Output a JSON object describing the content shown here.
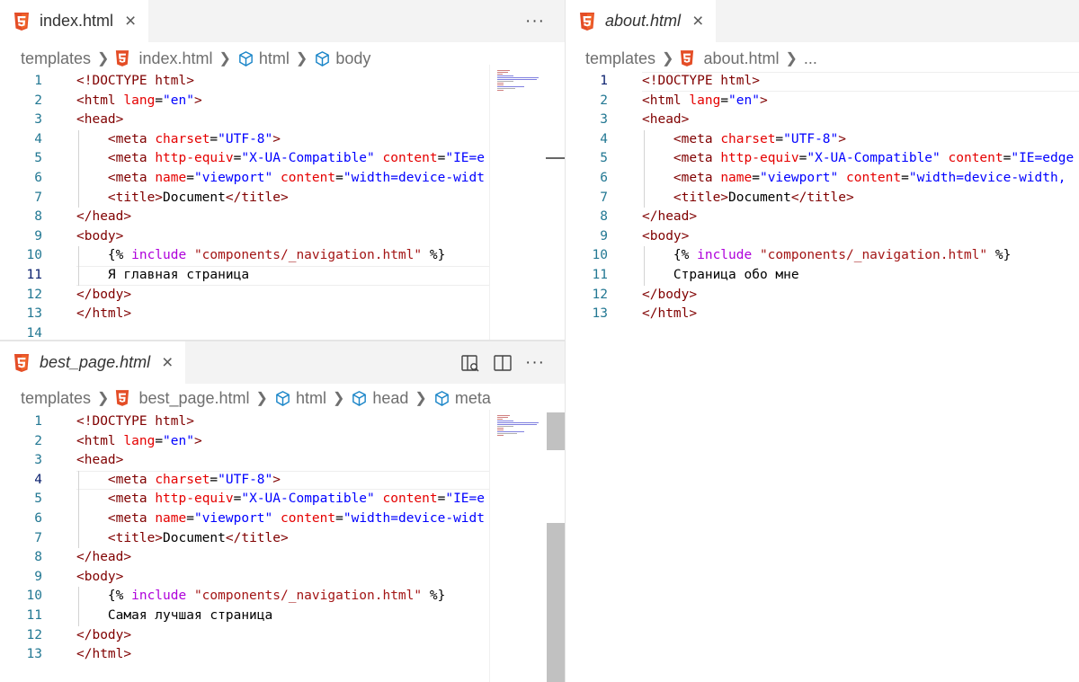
{
  "breadcrumb_root": "templates",
  "editors": {
    "index": {
      "tab": {
        "label": "index.html",
        "close": "×",
        "more": "···"
      },
      "breadcrumb": [
        "index.html",
        "html",
        "body"
      ],
      "lines": [
        {
          "n": "1",
          "parts": [
            [
              "t-tag",
              "<!DOCTYPE html>"
            ]
          ]
        },
        {
          "n": "2",
          "parts": [
            [
              "t-tag",
              "<html "
            ],
            [
              "t-attr",
              "lang"
            ],
            [
              "t-txt",
              "="
            ],
            [
              "t-str",
              "\"en\""
            ],
            [
              "t-tag",
              ">"
            ]
          ]
        },
        {
          "n": "3",
          "parts": [
            [
              "t-tag",
              "<head>"
            ]
          ]
        },
        {
          "n": "4",
          "parts": [
            [
              "t-txt",
              "    "
            ],
            [
              "t-tag",
              "<meta "
            ],
            [
              "t-attr",
              "charset"
            ],
            [
              "t-txt",
              "="
            ],
            [
              "t-str",
              "\"UTF-8\""
            ],
            [
              "t-tag",
              ">"
            ]
          ]
        },
        {
          "n": "5",
          "parts": [
            [
              "t-txt",
              "    "
            ],
            [
              "t-tag",
              "<meta "
            ],
            [
              "t-attr",
              "http-equiv"
            ],
            [
              "t-txt",
              "="
            ],
            [
              "t-str",
              "\"X-UA-Compatible\""
            ],
            [
              "t-txt",
              " "
            ],
            [
              "t-attr",
              "content"
            ],
            [
              "t-txt",
              "="
            ],
            [
              "t-str",
              "\"IE=e"
            ]
          ]
        },
        {
          "n": "6",
          "parts": [
            [
              "t-txt",
              "    "
            ],
            [
              "t-tag",
              "<meta "
            ],
            [
              "t-attr",
              "name"
            ],
            [
              "t-txt",
              "="
            ],
            [
              "t-str",
              "\"viewport\""
            ],
            [
              "t-txt",
              " "
            ],
            [
              "t-attr",
              "content"
            ],
            [
              "t-txt",
              "="
            ],
            [
              "t-str",
              "\"width=device-widt"
            ]
          ]
        },
        {
          "n": "7",
          "parts": [
            [
              "t-txt",
              "    "
            ],
            [
              "t-tag",
              "<title>"
            ],
            [
              "t-txt",
              "Document"
            ],
            [
              "t-tag",
              "</title>"
            ]
          ]
        },
        {
          "n": "8",
          "parts": [
            [
              "t-tag",
              "</head>"
            ]
          ]
        },
        {
          "n": "9",
          "parts": [
            [
              "t-tag",
              "<body>"
            ]
          ]
        },
        {
          "n": "10",
          "parts": [
            [
              "t-txt",
              "    {% "
            ],
            [
              "t-kw",
              "include"
            ],
            [
              "t-txt",
              " "
            ],
            [
              "t-str2",
              "\"components/_navigation.html\""
            ],
            [
              "t-txt",
              " %}"
            ]
          ]
        },
        {
          "n": "11",
          "parts": [
            [
              "t-txt",
              "    Я главная страница"
            ]
          ]
        },
        {
          "n": "12",
          "parts": [
            [
              "t-tag",
              "</body>"
            ]
          ]
        },
        {
          "n": "13",
          "parts": [
            [
              "t-tag",
              "</html>"
            ]
          ]
        },
        {
          "n": "14",
          "parts": []
        }
      ],
      "active_line": "11"
    },
    "about": {
      "tab": {
        "label": "about.html",
        "close": "×"
      },
      "breadcrumb": [
        "about.html",
        "..."
      ],
      "lines": [
        {
          "n": "1",
          "parts": [
            [
              "t-tag",
              "<!DOCTYPE html>"
            ]
          ]
        },
        {
          "n": "2",
          "parts": [
            [
              "t-tag",
              "<html "
            ],
            [
              "t-attr",
              "lang"
            ],
            [
              "t-txt",
              "="
            ],
            [
              "t-str",
              "\"en\""
            ],
            [
              "t-tag",
              ">"
            ]
          ]
        },
        {
          "n": "3",
          "parts": [
            [
              "t-tag",
              "<head>"
            ]
          ]
        },
        {
          "n": "4",
          "parts": [
            [
              "t-txt",
              "    "
            ],
            [
              "t-tag",
              "<meta "
            ],
            [
              "t-attr",
              "charset"
            ],
            [
              "t-txt",
              "="
            ],
            [
              "t-str",
              "\"UTF-8\""
            ],
            [
              "t-tag",
              ">"
            ]
          ]
        },
        {
          "n": "5",
          "parts": [
            [
              "t-txt",
              "    "
            ],
            [
              "t-tag",
              "<meta "
            ],
            [
              "t-attr",
              "http-equiv"
            ],
            [
              "t-txt",
              "="
            ],
            [
              "t-str",
              "\"X-UA-Compatible\""
            ],
            [
              "t-txt",
              " "
            ],
            [
              "t-attr",
              "content"
            ],
            [
              "t-txt",
              "="
            ],
            [
              "t-str",
              "\"IE=edge"
            ]
          ]
        },
        {
          "n": "6",
          "parts": [
            [
              "t-txt",
              "    "
            ],
            [
              "t-tag",
              "<meta "
            ],
            [
              "t-attr",
              "name"
            ],
            [
              "t-txt",
              "="
            ],
            [
              "t-str",
              "\"viewport\""
            ],
            [
              "t-txt",
              " "
            ],
            [
              "t-attr",
              "content"
            ],
            [
              "t-txt",
              "="
            ],
            [
              "t-str",
              "\"width=device-width,"
            ]
          ]
        },
        {
          "n": "7",
          "parts": [
            [
              "t-txt",
              "    "
            ],
            [
              "t-tag",
              "<title>"
            ],
            [
              "t-txt",
              "Document"
            ],
            [
              "t-tag",
              "</title>"
            ]
          ]
        },
        {
          "n": "8",
          "parts": [
            [
              "t-tag",
              "</head>"
            ]
          ]
        },
        {
          "n": "9",
          "parts": [
            [
              "t-tag",
              "<body>"
            ]
          ]
        },
        {
          "n": "10",
          "parts": [
            [
              "t-txt",
              "    {% "
            ],
            [
              "t-kw",
              "include"
            ],
            [
              "t-txt",
              " "
            ],
            [
              "t-str2",
              "\"components/_navigation.html\""
            ],
            [
              "t-txt",
              " %}"
            ]
          ]
        },
        {
          "n": "11",
          "parts": [
            [
              "t-txt",
              "    Страница обо мне"
            ]
          ]
        },
        {
          "n": "12",
          "parts": [
            [
              "t-tag",
              "</body>"
            ]
          ]
        },
        {
          "n": "13",
          "parts": [
            [
              "t-tag",
              "</html>"
            ]
          ]
        }
      ],
      "active_line": "1"
    },
    "best": {
      "tab": {
        "label": "best_page.html",
        "close": "×",
        "more": "···"
      },
      "breadcrumb": [
        "best_page.html",
        "html",
        "head",
        "meta"
      ],
      "lines": [
        {
          "n": "1",
          "parts": [
            [
              "t-tag",
              "<!DOCTYPE html>"
            ]
          ]
        },
        {
          "n": "2",
          "parts": [
            [
              "t-tag",
              "<html "
            ],
            [
              "t-attr",
              "lang"
            ],
            [
              "t-txt",
              "="
            ],
            [
              "t-str",
              "\"en\""
            ],
            [
              "t-tag",
              ">"
            ]
          ]
        },
        {
          "n": "3",
          "parts": [
            [
              "t-tag",
              "<head>"
            ]
          ]
        },
        {
          "n": "4",
          "parts": [
            [
              "t-txt",
              "    "
            ],
            [
              "t-tag",
              "<meta "
            ],
            [
              "t-attr",
              "charset"
            ],
            [
              "t-txt",
              "="
            ],
            [
              "t-str",
              "\"UTF-8\""
            ],
            [
              "t-tag",
              ">"
            ]
          ]
        },
        {
          "n": "5",
          "parts": [
            [
              "t-txt",
              "    "
            ],
            [
              "t-tag",
              "<meta "
            ],
            [
              "t-attr",
              "http-equiv"
            ],
            [
              "t-txt",
              "="
            ],
            [
              "t-str",
              "\"X-UA-Compatible\""
            ],
            [
              "t-txt",
              " "
            ],
            [
              "t-attr",
              "content"
            ],
            [
              "t-txt",
              "="
            ],
            [
              "t-str",
              "\"IE=e"
            ]
          ]
        },
        {
          "n": "6",
          "parts": [
            [
              "t-txt",
              "    "
            ],
            [
              "t-tag",
              "<meta "
            ],
            [
              "t-attr",
              "name"
            ],
            [
              "t-txt",
              "="
            ],
            [
              "t-str",
              "\"viewport\""
            ],
            [
              "t-txt",
              " "
            ],
            [
              "t-attr",
              "content"
            ],
            [
              "t-txt",
              "="
            ],
            [
              "t-str",
              "\"width=device-widt"
            ]
          ]
        },
        {
          "n": "7",
          "parts": [
            [
              "t-txt",
              "    "
            ],
            [
              "t-tag",
              "<title>"
            ],
            [
              "t-txt",
              "Document"
            ],
            [
              "t-tag",
              "</title>"
            ]
          ]
        },
        {
          "n": "8",
          "parts": [
            [
              "t-tag",
              "</head>"
            ]
          ]
        },
        {
          "n": "9",
          "parts": [
            [
              "t-tag",
              "<body>"
            ]
          ]
        },
        {
          "n": "10",
          "parts": [
            [
              "t-txt",
              "    {% "
            ],
            [
              "t-kw",
              "include"
            ],
            [
              "t-txt",
              " "
            ],
            [
              "t-str2",
              "\"components/_navigation.html\""
            ],
            [
              "t-txt",
              " %}"
            ]
          ]
        },
        {
          "n": "11",
          "parts": [
            [
              "t-txt",
              "    Самая лучшая страница"
            ]
          ]
        },
        {
          "n": "12",
          "parts": [
            [
              "t-tag",
              "</body>"
            ]
          ]
        },
        {
          "n": "13",
          "parts": [
            [
              "t-tag",
              "</html>"
            ]
          ]
        }
      ],
      "active_line": "4"
    }
  },
  "icons": {
    "file_icon": "html5-icon",
    "symbol_icon": "cube-icon",
    "breadcrumb_separator": "chevron-right-icon",
    "open_changes": "open-changes-icon",
    "split_editor": "split-editor-icon",
    "more": "more-actions-icon"
  },
  "colors": {
    "html5_orange": "#e44d26",
    "html5_shade": "#f16529",
    "tag": "#800000",
    "attribute": "#e50000",
    "string": "#0000ff",
    "keyword": "#af00db",
    "line_number": "#237893",
    "active_line_number": "#0b216f"
  }
}
